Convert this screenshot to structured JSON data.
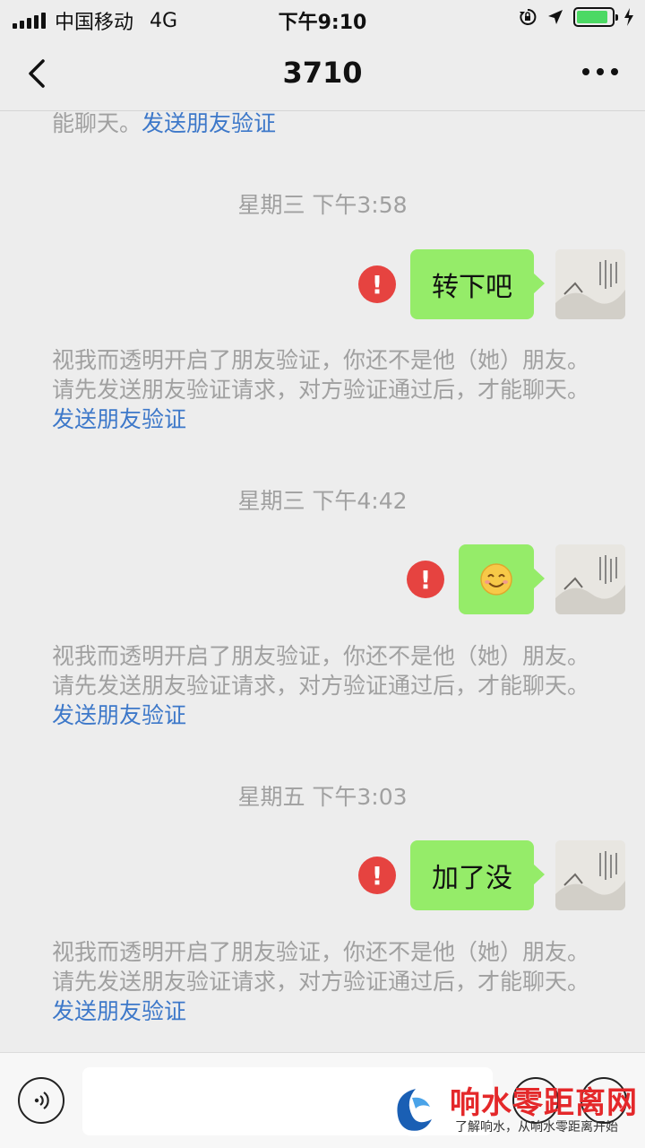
{
  "status_bar": {
    "carrier": "中国移动",
    "network": "4G",
    "time": "下午9:10",
    "battery_level": 0.9,
    "icons": [
      "signal-icon",
      "orientation-lock-icon",
      "location-icon",
      "battery-icon",
      "charging-icon"
    ]
  },
  "nav": {
    "title": "3710",
    "back_icon": "chevron-left-icon",
    "more_icon": "more-icon"
  },
  "notice": {
    "text": "视我而透明开启了朋友验证，你还不是他（她）朋友。请先发送朋友验证请求，对方验证通过后，才能聊天。",
    "partial_text": "能聊天。",
    "link": "发送朋友验证"
  },
  "messages": [
    {
      "timestamp": "星期三 下午3:58",
      "text": "转下吧",
      "status": "failed"
    },
    {
      "timestamp": "星期三 下午4:42",
      "text": "",
      "emoji": "smile-emoji-icon",
      "status": "failed"
    },
    {
      "timestamp": "星期五 下午3:03",
      "text": "加了没",
      "status": "failed"
    }
  ],
  "error_mark": "!",
  "input_bar": {
    "voice_icon": "voice-icon",
    "text_value": "",
    "emoji_icon": "emoji-icon",
    "plus_icon": "plus-icon"
  },
  "watermark": {
    "title": "响水零距离网",
    "subtitle": "了解响水，从响水零距离开始"
  },
  "colors": {
    "background": "#ededed",
    "bubble": "#95ec69",
    "link": "#3d78c9",
    "error": "#e64340",
    "notice_text": "#a0a0a0"
  }
}
